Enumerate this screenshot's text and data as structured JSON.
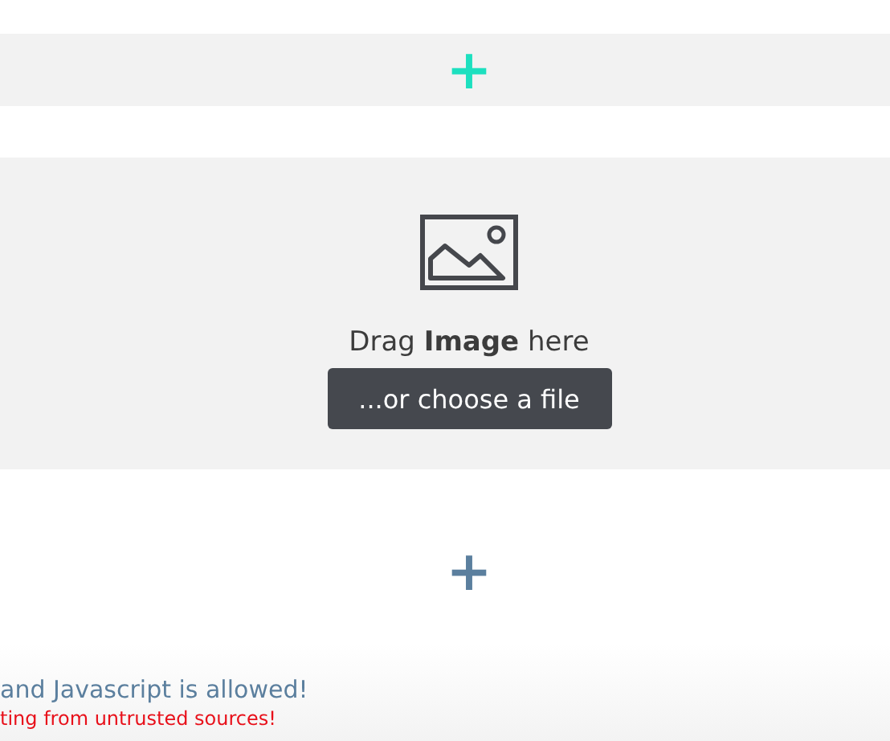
{
  "top_bar": {
    "add": "+"
  },
  "dropzone": {
    "prompt": "Drag **Image** here",
    "button": "...or choose a file"
  },
  "add_below": "+",
  "notes": [
    {
      "text": "and Javascript is allowed!",
      "kind": "info"
    },
    {
      "text": "ting from untrusted sources!",
      "kind": "warning"
    }
  ]
}
